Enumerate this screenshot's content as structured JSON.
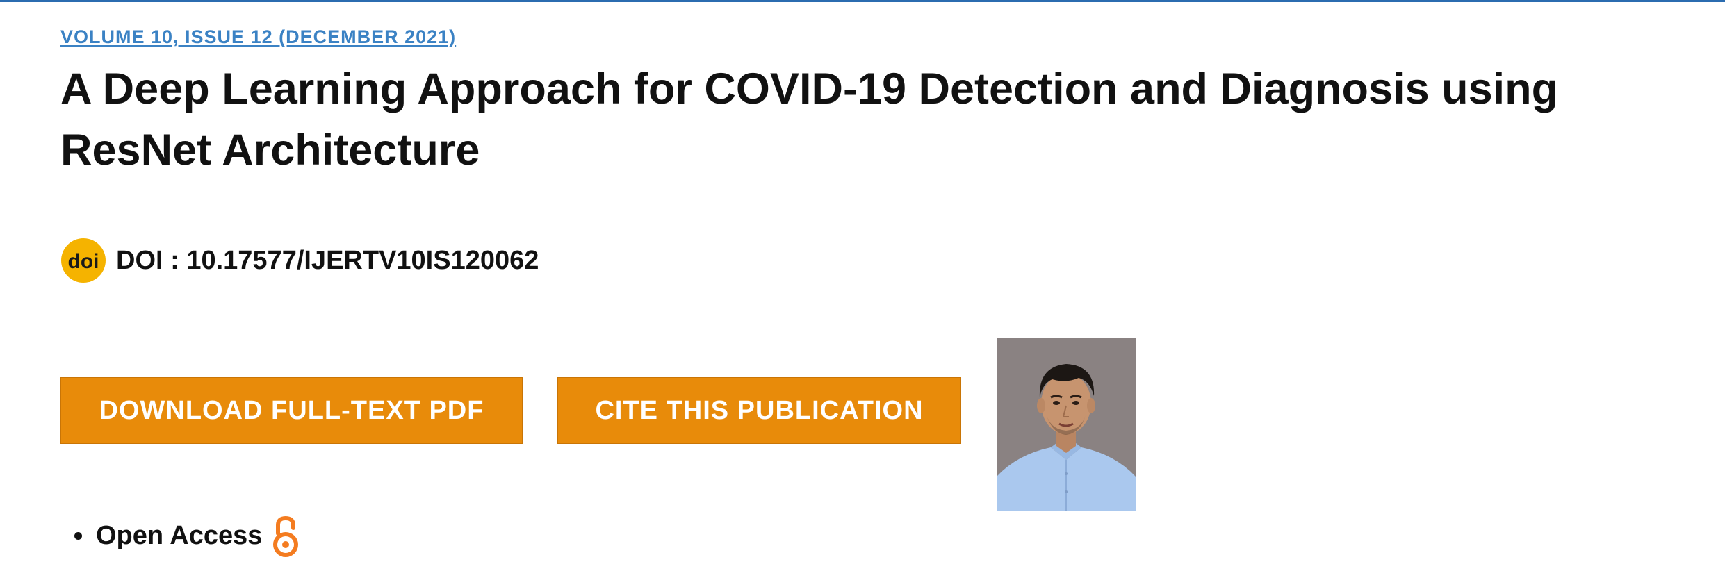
{
  "issue": {
    "label": "VOLUME 10, ISSUE 12 (DECEMBER 2021)"
  },
  "article": {
    "title": "A Deep Learning Approach for COVID-19 Detection and Diagnosis using ResNet Architecture"
  },
  "doi": {
    "logo_text": "doi",
    "text": "DOI : 10.17577/IJERTV10IS120062",
    "logo_color": "#f5b300"
  },
  "actions": {
    "download_label": "DOWNLOAD FULL-TEXT PDF",
    "cite_label": "CITE THIS PUBLICATION",
    "button_color": "#e88b0a"
  },
  "author_photo": {
    "alt": "Author photo",
    "icon": "portrait-photo"
  },
  "features": [
    {
      "label": "Open Access",
      "icon": "open-access-icon"
    }
  ],
  "colors": {
    "link": "#3b82c4",
    "accent_rule": "#2b6cb0",
    "open_access": "#f47c20"
  }
}
